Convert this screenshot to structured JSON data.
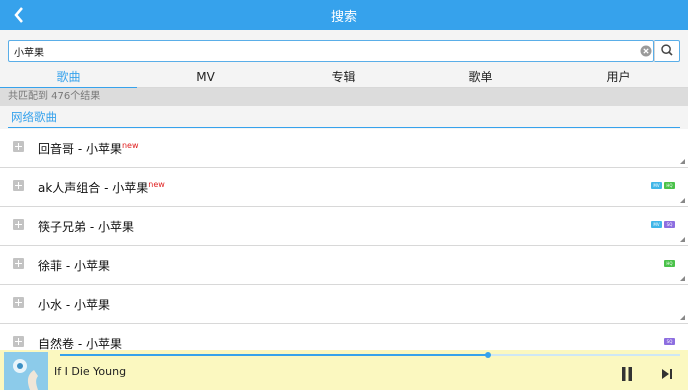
{
  "header": {
    "title": "搜索",
    "back_icon": "chevron-left-icon"
  },
  "search": {
    "value": "小苹果",
    "placeholder": ""
  },
  "tabs": [
    {
      "label": "歌曲",
      "active": true
    },
    {
      "label": "MV",
      "active": false
    },
    {
      "label": "专辑",
      "active": false
    },
    {
      "label": "歌单",
      "active": false
    },
    {
      "label": "用户",
      "active": false
    }
  ],
  "result_count": "共匹配到 476个结果",
  "section_title": "网络歌曲",
  "songs": [
    {
      "name": "回音哥 - 小苹果",
      "new": "new",
      "badges": []
    },
    {
      "name": "ak人声组合 - 小苹果",
      "new": "new",
      "badges": [
        "MV",
        "HQ"
      ]
    },
    {
      "name": "筷子兄弟 - 小苹果",
      "new": "",
      "badges": [
        "MV",
        "SQ"
      ]
    },
    {
      "name": "徐菲 - 小苹果",
      "new": "",
      "badges": [
        "HQ"
      ]
    },
    {
      "name": "小水 - 小苹果",
      "new": "",
      "badges": []
    },
    {
      "name": "自然卷 - 小苹果",
      "new": "",
      "badges": [
        "SQ"
      ]
    }
  ],
  "player": {
    "song_title": "If I Die Young",
    "progress": 0.69
  },
  "colors": {
    "accent": "#36a2ec",
    "player_bg": "#fbf8c0",
    "new_tag": "#e02020"
  }
}
